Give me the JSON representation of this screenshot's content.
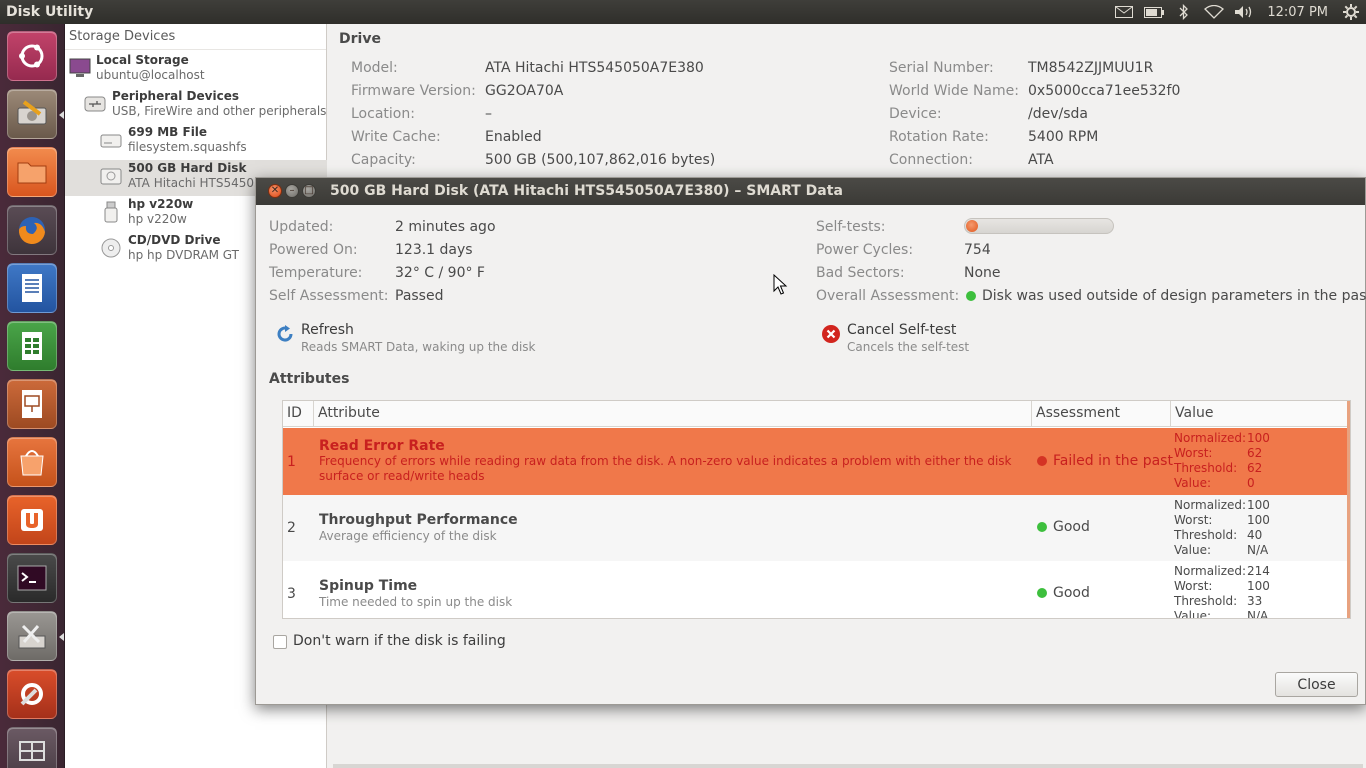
{
  "topbar": {
    "app_title": "Disk Utility",
    "clock": "12:07 PM",
    "indicators": [
      "mail-icon",
      "battery-icon",
      "bluetooth-icon",
      "wifi-icon",
      "volume-icon",
      "gear-icon"
    ]
  },
  "launcher": {
    "items": [
      "ubuntu-dash-icon",
      "disk-utility-icon",
      "files-icon",
      "firefox-icon",
      "writer-icon",
      "calc-icon",
      "impress-icon",
      "software-center-icon",
      "ubuntu-one-icon",
      "terminal-icon",
      "settings-tools-icon",
      "system-settings-icon",
      "workspace-switcher-icon"
    ]
  },
  "sidebar": {
    "header": "Storage Devices",
    "items": [
      {
        "title": "Local Storage",
        "subtitle": "ubuntu@localhost"
      },
      {
        "title": "Peripheral Devices",
        "subtitle": "USB, FireWire and other peripherals"
      },
      {
        "title": "699 MB File",
        "subtitle": "filesystem.squashfs"
      },
      {
        "title": "500 GB Hard Disk",
        "subtitle": "ATA Hitachi HTS54505"
      },
      {
        "title": "hp v220w",
        "subtitle": "hp v220w"
      },
      {
        "title": "CD/DVD Drive",
        "subtitle": "hp hp      DVDRAM GT"
      }
    ]
  },
  "drive": {
    "title": "Drive",
    "left": [
      {
        "key": "Model:",
        "value": "ATA Hitachi HTS545050A7E380"
      },
      {
        "key": "Firmware Version:",
        "value": "GG2OA70A"
      },
      {
        "key": "Location:",
        "value": "–"
      },
      {
        "key": "Write Cache:",
        "value": "Enabled"
      },
      {
        "key": "Capacity:",
        "value": "500 GB (500,107,862,016 bytes)"
      }
    ],
    "right": [
      {
        "key": "Serial Number:",
        "value": "TM8542ZJJMUU1R"
      },
      {
        "key": "World Wide Name:",
        "value": "0x5000cca71ee532f0"
      },
      {
        "key": "Device:",
        "value": "/dev/sda"
      },
      {
        "key": "Rotation Rate:",
        "value": "5400 RPM"
      },
      {
        "key": "Connection:",
        "value": "ATA"
      }
    ]
  },
  "dialog": {
    "title": "500 GB Hard Disk (ATA Hitachi HTS545050A7E380) – SMART Data",
    "left": [
      {
        "key": "Updated:",
        "value": "2 minutes ago"
      },
      {
        "key": "Powered On:",
        "value": "123.1 days"
      },
      {
        "key": "Temperature:",
        "value": "32° C / 90° F"
      },
      {
        "key": "Self Assessment:",
        "value": "Passed"
      }
    ],
    "right": [
      {
        "key": "Self-tests:",
        "value": ""
      },
      {
        "key": "Power Cycles:",
        "value": "754"
      },
      {
        "key": "Bad Sectors:",
        "value": "None"
      },
      {
        "key": "Overall Assessment:",
        "value": "Disk was used outside of design parameters in the past"
      }
    ],
    "self_test_progress": 0.06,
    "refresh": {
      "label": "Refresh",
      "description": "Reads SMART Data, waking up the disk"
    },
    "cancel_self_test": {
      "label": "Cancel Self-test",
      "description": "Cancels the self-test"
    },
    "attributes_title": "Attributes",
    "columns": [
      "ID",
      "Attribute",
      "Assessment",
      "Value"
    ],
    "rows": [
      {
        "id": "1",
        "name": "Read Error Rate",
        "description": "Frequency of errors while reading raw data from the disk. A non-zero value indicates a problem with either the disk surface or read/write heads",
        "assessment": "Failed in the past",
        "normalized": "100",
        "worst": "62",
        "threshold": "62",
        "value": "0"
      },
      {
        "id": "2",
        "name": "Throughput Performance",
        "description": "Average efficiency of the disk",
        "assessment": "Good",
        "normalized": "100",
        "worst": "100",
        "threshold": "40",
        "value": "N/A"
      },
      {
        "id": "3",
        "name": "Spinup Time",
        "description": "Time needed to spin up the disk",
        "assessment": "Good",
        "normalized": "214",
        "worst": "100",
        "threshold": "33",
        "value": "N/A"
      }
    ],
    "value_labels": {
      "normalized": "Normalized:",
      "worst": "Worst:",
      "threshold": "Threshold:",
      "value": "Value:"
    },
    "dont_warn_label": "Don't warn if the disk is failing",
    "close_label": "Close"
  },
  "colors": {
    "failed_row": "#f0784a",
    "failed_text": "#c8201f",
    "good_dot": "#3dbf3d",
    "accent": "#dd4814"
  }
}
